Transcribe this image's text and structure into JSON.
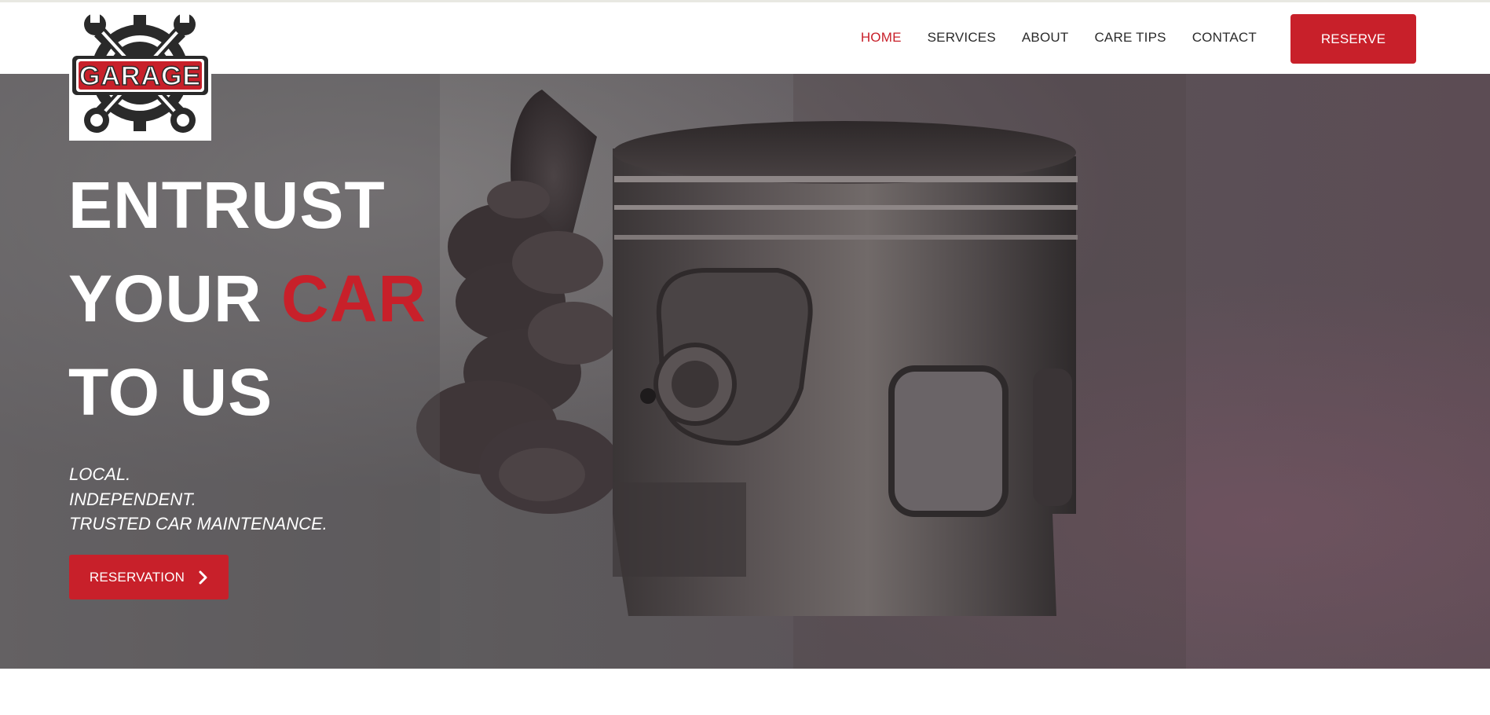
{
  "logo": {
    "text": "GARAGE",
    "icon": "garage-wrench-gear-logo"
  },
  "nav": {
    "items": [
      {
        "label": "HOME",
        "active": true
      },
      {
        "label": "SERVICES",
        "active": false
      },
      {
        "label": "ABOUT",
        "active": false
      },
      {
        "label": "CARE TIPS",
        "active": false
      },
      {
        "label": "CONTACT",
        "active": false
      }
    ],
    "reserve_label": "RESERVE"
  },
  "hero": {
    "title_line1": "ENTRUST",
    "title_line2_prefix": "YOUR ",
    "title_line2_accent": "CAR",
    "title_line3": "TO US",
    "tagline": [
      "LOCAL.",
      "INDEPENDENT.",
      "TRUSTED CAR MAINTENANCE."
    ],
    "cta_label": "RESERVATION",
    "cta_icon": "chevron-right-icon",
    "background_image": "hand-holding-engine-piston-photo"
  },
  "colors": {
    "accent": "#c8202a",
    "text_dark": "#2b2b2b",
    "white": "#ffffff"
  }
}
